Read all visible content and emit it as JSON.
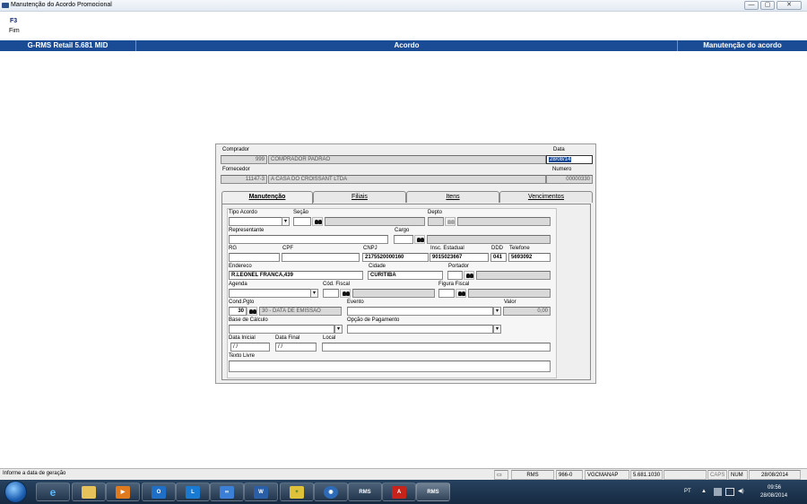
{
  "window": {
    "title": "Manutenção do Acordo Promocional",
    "minimize_glyph": "—",
    "maximize_glyph": "▢",
    "close_glyph": "✕"
  },
  "menu": {
    "fkey": "F3",
    "fkey_label": "Fim"
  },
  "header": {
    "app": "G-RMS Retail 5.681 MID",
    "section": "Acordo",
    "screen": "Manutenção do acordo"
  },
  "form": {
    "comprador_label": "Comprador",
    "comprador_code": "999",
    "comprador_name": "COMPRADOR PADRAO",
    "data_label": "Data",
    "data_value": "28/08/14",
    "fornecedor_label": "Fornecedor",
    "fornecedor_code": "11147-3",
    "fornecedor_name": "A CASA DO CROISSANT LTDA",
    "numero_label": "Numero",
    "numero_value": "00000330"
  },
  "tabs": [
    {
      "label": "Manutenção"
    },
    {
      "label": "Filiais"
    },
    {
      "label": "Itens"
    },
    {
      "label": "Vencimentos"
    }
  ],
  "fields": {
    "tipo_acordo_label": "Tipo Acordo",
    "secao_label": "Seção",
    "depto_label": "Depto",
    "representante_label": "Representante",
    "cargo_label": "Cargo",
    "rg_label": "RG",
    "cpf_label": "CPF",
    "cnpj_label": "CNPJ",
    "cnpj_value": "2175520000160",
    "insc_label": "Insc. Estadual",
    "insc_value": "9015023667",
    "ddd_label": "DDD",
    "ddd_value": "041",
    "telefone_label": "Telefone",
    "telefone_value": "5693092",
    "endereco_label": "Endereco",
    "endereco_value": "R.LEONEL FRANCA,439",
    "cidade_label": "Cidade",
    "cidade_value": "CURITIBA",
    "portador_label": "Portador",
    "agenda_label": "Agenda",
    "cod_fiscal_label": "Cód. Fiscal",
    "figura_fiscal_label": "Figura Fiscal",
    "cond_pgto_label": "Cond.Pgto",
    "cond_pgto_code": "30",
    "cond_pgto_desc": "30 - DATA DE EMISSAO",
    "evento_label": "Evento",
    "valor_label": "Valor",
    "valor_value": "0,00",
    "base_calculo_label": "Base de Cálculo",
    "opcao_pagamento_label": "Opção de Pagamento",
    "data_inicial_label": "Data Inicial",
    "data_inicial_value": " / /",
    "data_final_label": "Data Final",
    "data_final_value": " / /",
    "local_label": "Local",
    "texto_livre_label": "Texto Livre"
  },
  "status": {
    "message": "Informe a data de geração",
    "rms": "RMS",
    "code": "966-0",
    "user": "VGCMANAP",
    "version": "5.681.1030",
    "caps": "CAPS",
    "num": "NUM",
    "date": "28/08/2014"
  },
  "taskbar": {
    "lang": "PT",
    "time": "09:56",
    "date": "28/08/2014",
    "rms_label": "RMS"
  },
  "colors": {
    "accent": "#1a4c96",
    "taskbar": "#1f3650"
  }
}
